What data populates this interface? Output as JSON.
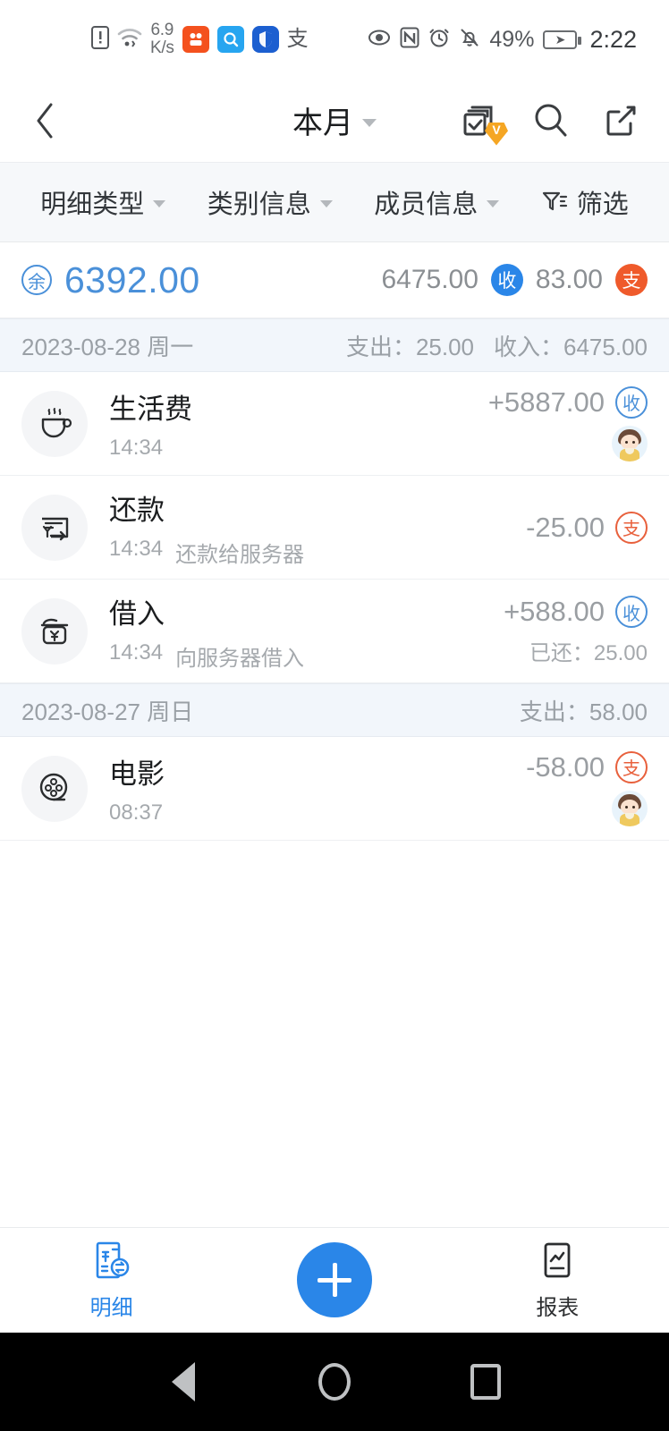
{
  "statusbar": {
    "sim_icon": "sim-alert-icon",
    "wifi_icon": "wifi-icon",
    "netspeed_value": "6.9",
    "netspeed_unit": "K/s",
    "app_icons": [
      {
        "name": "kuaishou-app-icon",
        "glyph": "⠿",
        "color": "#f4511e"
      },
      {
        "name": "search-app-icon",
        "glyph": "Q",
        "color": "#27a5f0"
      },
      {
        "name": "shield-app-icon",
        "glyph": "◗",
        "color": "#1c5fd0"
      }
    ],
    "alipay_glyph": "支",
    "eye_comfort_icon": "eye-comfort-icon",
    "nfc_icon": "nfc-icon",
    "alarm_icon": "alarm-icon",
    "mute_icon": "bell-mute-icon",
    "battery_percent": "49%",
    "battery_icon": "battery-charging-icon",
    "time": "2:22"
  },
  "header": {
    "back_icon": "back-chevron-icon",
    "title": "本月",
    "dropdown_icon": "chevron-down-icon",
    "batch_select_icon": "batch-select-icon",
    "vip_badge_label": "V",
    "search_icon": "search-icon",
    "share_icon": "share-icon"
  },
  "filterbar": {
    "items": [
      {
        "label": "明细类型",
        "has_dropdown": true
      },
      {
        "label": "类别信息",
        "has_dropdown": true
      },
      {
        "label": "成员信息",
        "has_dropdown": true
      }
    ],
    "filter_label": "筛选",
    "filter_icon": "funnel-icon"
  },
  "summary": {
    "balance_badge": "余",
    "balance_amount": "6392.00",
    "income_amount": "6475.00",
    "income_badge": "收",
    "expense_amount": "83.00",
    "expense_badge": "支",
    "balance_color": "#4a90d9",
    "income_color": "#2a86e8",
    "expense_color": "#ef5a2b"
  },
  "groups": [
    {
      "date": "2023-08-28 周一",
      "expense_label": "支出：25.00",
      "income_label": "收入：6475.00",
      "rows": [
        {
          "icon": "coffee-cup-icon",
          "title": "生活费",
          "time": "14:34",
          "note": "",
          "amount": "+5887.00",
          "badge": "收",
          "badge_type": "inc",
          "right_note": "",
          "has_avatar": true
        },
        {
          "icon": "repayment-card-icon",
          "title": "还款",
          "time": "14:34",
          "note": "还款给服务器",
          "amount": "-25.00",
          "badge": "支",
          "badge_type": "exp",
          "right_note": "",
          "has_avatar": false
        },
        {
          "icon": "borrow-wallet-icon",
          "title": "借入",
          "time": "14:34",
          "note": "向服务器借入",
          "amount": "+588.00",
          "badge": "收",
          "badge_type": "inc",
          "right_note": "已还：25.00",
          "has_avatar": false
        }
      ]
    },
    {
      "date": "2023-08-27 周日",
      "expense_label": "支出：58.00",
      "income_label": "",
      "rows": [
        {
          "icon": "film-reel-icon",
          "title": "电影",
          "time": "08:37",
          "note": "",
          "amount": "-58.00",
          "badge": "支",
          "badge_type": "exp",
          "right_note": "",
          "has_avatar": true
        }
      ]
    }
  ],
  "bottomnav": {
    "detail_icon": "receipt-exchange-icon",
    "detail_label": "明细",
    "add_icon": "plus-icon",
    "report_icon": "report-chart-icon",
    "report_label": "报表"
  },
  "androidnav": {
    "back": "android-back-icon",
    "home": "android-home-icon",
    "recents": "android-recents-icon"
  }
}
